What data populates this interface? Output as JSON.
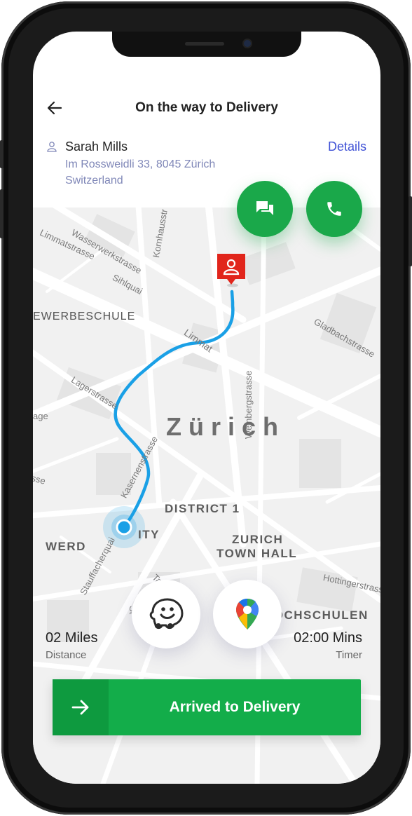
{
  "header": {
    "title": "On the way to Delivery"
  },
  "customer": {
    "name": "Sarah Mills",
    "address_line1": "Im Rossweidli 33, 8045 Zürich",
    "address_line2": "Switzerland",
    "details_label": "Details"
  },
  "map": {
    "city": "Zürich",
    "districts": [
      "DISTRICT 1",
      "ZURICH",
      "TOWN HALL",
      "WERD",
      "EWERBESCHULE",
      "ITY",
      "HOCHSCHULEN"
    ],
    "streets": [
      "Wasserwerkstrasse",
      "Limmatstrasse",
      "Kornhausstr",
      "Sihlquai",
      "Limmat",
      "Weinbergstrasse",
      "Gladbachstrasse",
      "Lagerstrasse",
      "Kasernenstrasse",
      "Stauffacherquai",
      "Talstrasse",
      "Hottingerstrasse",
      "age",
      "sse",
      "St"
    ]
  },
  "stats": {
    "distance_value": "02 Miles",
    "distance_label": "Distance",
    "timer_value": "02:00 Mins",
    "timer_label": "Timer"
  },
  "action": {
    "label": "Arrived to Delivery"
  },
  "colors": {
    "primary_green": "#13ad4a",
    "route_blue": "#1aa0e6",
    "pin_red": "#e1251b",
    "link_blue": "#3f51d6"
  },
  "icons": [
    "back-arrow-icon",
    "person-icon",
    "chat-icon",
    "phone-icon",
    "map-pin-icon",
    "waze-icon",
    "google-maps-icon",
    "arrow-right-icon"
  ]
}
